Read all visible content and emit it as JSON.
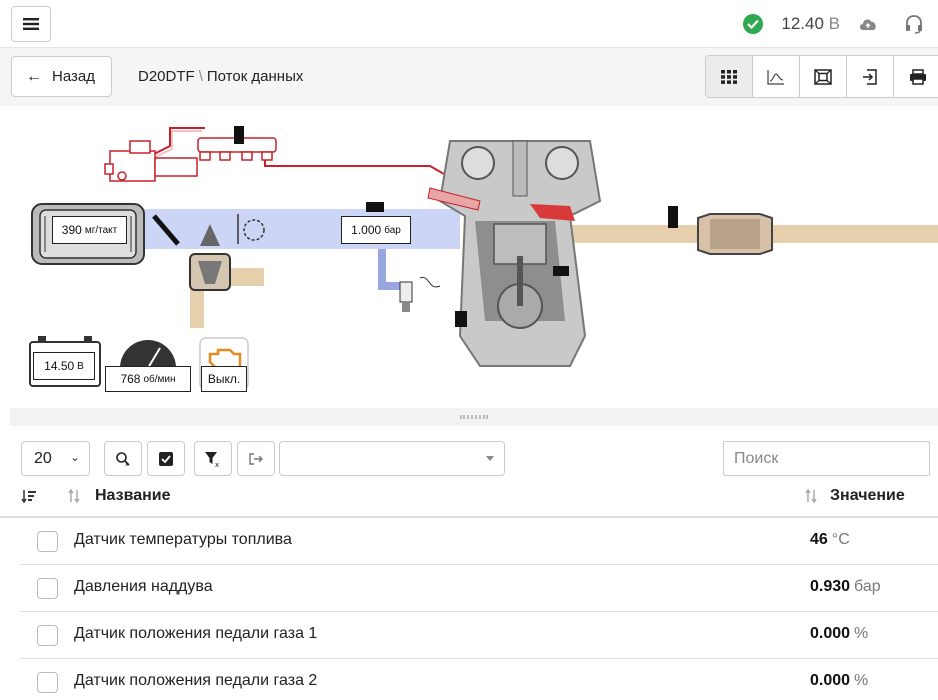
{
  "topbar": {
    "menu_icon": "hamburger-icon",
    "status_icon": "check-circle-icon",
    "voltage_value": "12.40",
    "voltage_unit": "В",
    "cloud_icon": "cloud-upload-icon",
    "support_icon": "headset-icon",
    "status_color": "#2fa84f"
  },
  "nav": {
    "back_label": "Назад",
    "breadcrumb_vehicle": "D20DTF",
    "breadcrumb_separator": "\\",
    "breadcrumb_page": "Поток данных",
    "toolbar_icons": [
      "grid-view-icon",
      "chart-view-icon",
      "diagram-view-icon",
      "export-icon",
      "print-icon"
    ]
  },
  "diagram": {
    "fuel_amount_value": "390",
    "fuel_amount_unit": "мг/такт",
    "boost_pressure_value": "1.000",
    "boost_pressure_unit": "бар",
    "battery_value": "14.50",
    "battery_unit": "В",
    "rpm_value": "768",
    "rpm_unit": "об/мин",
    "check_engine_value": "Выкл.",
    "colors": {
      "intake_air": "#cdd5f7",
      "exhaust": "#e6cfad",
      "fuel_line": "#c8202a",
      "engine_gray": "#9a9a9a"
    }
  },
  "controls": {
    "page_size": "20",
    "clear_selection_icon": "clear-search-icon",
    "select_all_icon": "checkbox-checked-icon",
    "clear_filter_icon": "filter-clear-icon",
    "export_icon": "share-export-icon",
    "combo_value": "",
    "search_placeholder": "Поиск"
  },
  "table": {
    "header_sort_icon": "sort-desc-icon",
    "header_name": "Название",
    "header_value": "Значение",
    "rows": [
      {
        "name": "Датчик температуры топлива",
        "value": "46",
        "unit": "°C"
      },
      {
        "name": "Давления наддува",
        "value": "0.930",
        "unit": "бар"
      },
      {
        "name": "Датчик положения педали газа 1",
        "value": "0.000",
        "unit": "%"
      },
      {
        "name": "Датчик положения педали газа 2",
        "value": "0.000",
        "unit": "%"
      }
    ]
  }
}
